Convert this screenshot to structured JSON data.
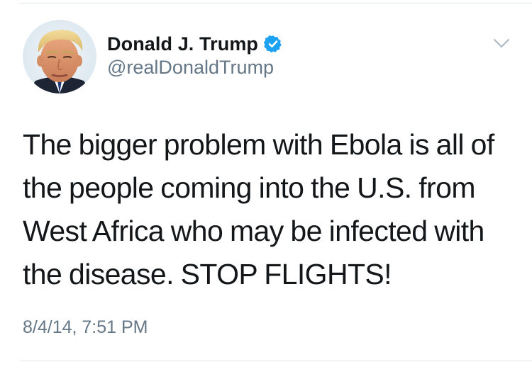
{
  "author": {
    "display_name": "Donald J. Trump",
    "handle": "@realDonaldTrump",
    "verified": true,
    "verified_color": "#1da1f2",
    "avatar_icon": "profile-photo"
  },
  "tweet": {
    "lines": [
      "The bigger problem with Ebola is all of",
      "the people coming into the U.S. from",
      "West Africa who may be infected with",
      "the disease. STOP FLIGHTS!"
    ],
    "timestamp": "8/4/14, 7:51 PM"
  },
  "menu": {
    "icon": "chevron-down-icon"
  },
  "colors": {
    "text_primary": "#14171a",
    "text_secondary": "#657786",
    "divider": "#e1e8ed"
  }
}
